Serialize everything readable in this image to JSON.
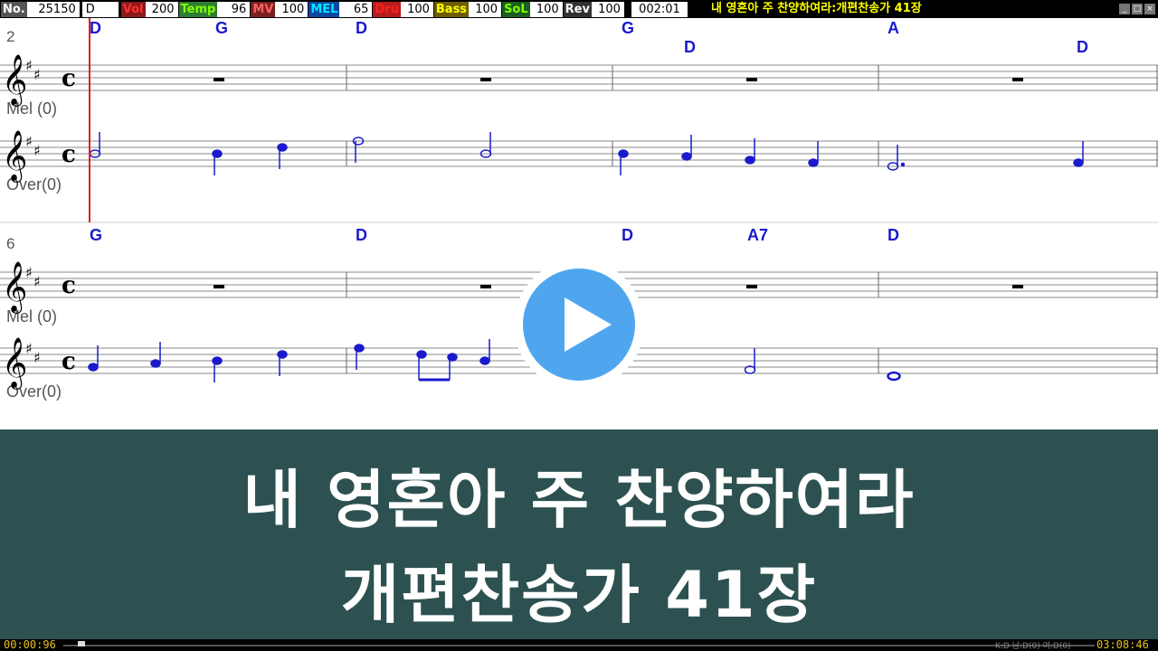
{
  "status_bar": {
    "fields": [
      {
        "label": "No.",
        "value": "25150",
        "label_color": "#ffffff",
        "label_bg": "#000000"
      },
      {
        "label": "",
        "value": "D",
        "label_color": "#ffffff",
        "label_bg": "#000000"
      },
      {
        "label": "Vol",
        "value": "200",
        "label_color": "#ff3030",
        "label_bg": "#8b1a1a"
      },
      {
        "label": "Temp",
        "value": "96",
        "label_color": "#7fff00",
        "label_bg": "#2e7d32"
      },
      {
        "label": "MV",
        "value": "100",
        "label_color": "#ff6060",
        "label_bg": "#7a2020"
      },
      {
        "label": "MEL",
        "value": "65",
        "label_color": "#00e5ff",
        "label_bg": "#0d47a1"
      },
      {
        "label": "Dru",
        "value": "100",
        "label_color": "#ff2020",
        "label_bg": "#b71c1c"
      },
      {
        "label": "Bass",
        "value": "100",
        "label_color": "#ffff00",
        "label_bg": "#6d5d00"
      },
      {
        "label": "SoL",
        "value": "100",
        "label_color": "#7fff00",
        "label_bg": "#1b5e20"
      },
      {
        "label": "Rev",
        "value": "100",
        "label_color": "#ffffff",
        "label_bg": "#000000"
      },
      {
        "label": "",
        "value": "002:01",
        "label_color": "#ffffff",
        "label_bg": "#000000"
      }
    ],
    "song_title": "내 영혼아 주 찬양하여라:개편찬송가 41장"
  },
  "score": {
    "systems": [
      {
        "measure_number": "2",
        "chords": [
          "D",
          "G",
          "D",
          "G",
          "D",
          "A",
          "D"
        ],
        "mel_label": "Mel (0)",
        "over_label": "Over(0)"
      },
      {
        "measure_number": "6",
        "chords": [
          "G",
          "D",
          "D",
          "A7",
          "D"
        ],
        "mel_label": "Mel (0)",
        "over_label": "Over(0)"
      }
    ],
    "note_color": "#1a1acd",
    "cursor_color": "#e02020"
  },
  "banner": {
    "line1": "내 영혼아 주 찬양하여라",
    "line2": "개편찬송가 41장",
    "bg_color": "#2d5151"
  },
  "bottom_bar": {
    "elapsed": "00:00:96",
    "total": "03:08:46",
    "info": "K:D 남:D(0) 여:D(0)",
    "progress": 0.01
  },
  "icons": [
    "play-icon",
    "minimize-icon",
    "restore-icon",
    "close-icon"
  ]
}
